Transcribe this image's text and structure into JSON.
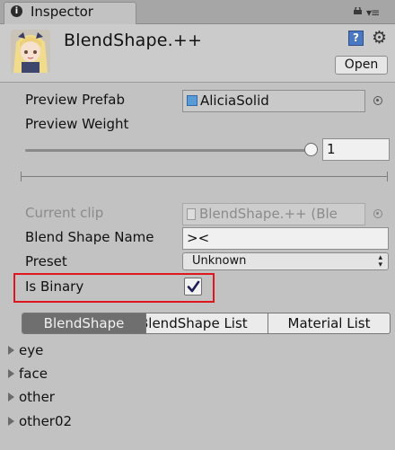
{
  "tab": {
    "title": "Inspector",
    "info_icon": "i"
  },
  "header": {
    "title": "BlendShape.++",
    "help_icon": "?",
    "gear_icon": "⚙",
    "open_label": "Open"
  },
  "fields": {
    "preview_prefab_label": "Preview Prefab",
    "preview_prefab_value": "AliciaSolid",
    "preview_weight_label": "Preview Weight",
    "preview_weight_value": "1",
    "preview_weight_fraction": 1.0,
    "current_clip_label": "Current clip",
    "current_clip_value": "BlendShape.++ (Ble",
    "blend_shape_name_label": "Blend Shape Name",
    "blend_shape_name_value": "><",
    "preset_label": "Preset",
    "preset_value": "Unknown",
    "is_binary_label": "Is Binary",
    "is_binary_checked": true
  },
  "tabs": [
    {
      "label": "BlendShape",
      "selected": true
    },
    {
      "label": "BlendShape List",
      "selected": false
    },
    {
      "label": "Material List",
      "selected": false
    }
  ],
  "tree": [
    {
      "label": "eye"
    },
    {
      "label": "face"
    },
    {
      "label": "other"
    },
    {
      "label": "other02"
    }
  ],
  "colors": {
    "highlight": "#e0161e",
    "selected_tab": "#6f6f6f",
    "panel_bg": "#c2c2c2"
  }
}
